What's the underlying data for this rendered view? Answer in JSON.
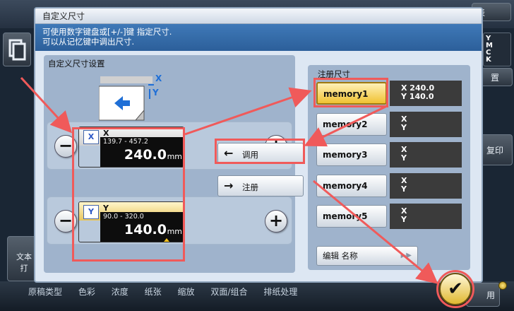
{
  "background": {
    "tab_right": "表",
    "right_button_top": "置",
    "right_button_mid": "复印",
    "cmyk_letters": "Y\nM\nC\nK",
    "left_button": "文本\n打",
    "bottom_bar": "原稿类型      色彩      浓度      纸张      缩放      双面/组合      排纸处理",
    "ok_button": "用"
  },
  "dialog": {
    "title": "自定义尺寸",
    "message_line1": "可使用数字键盘或[+/-]键 指定尺寸.",
    "message_line2": "可以从记忆键中调出尺寸."
  },
  "size_settings": {
    "title": "自定义尺寸设置",
    "diagram": {
      "x_label": "X",
      "y_label": "Y"
    },
    "x": {
      "axis": "X",
      "range": "139.7 - 457.2",
      "value": "240.0",
      "unit": "mm"
    },
    "y": {
      "axis": "Y",
      "range": "90.0 - 320.0",
      "value": "140.0",
      "unit": "mm"
    },
    "minus_label": "−",
    "plus_label": "+"
  },
  "middle_buttons": {
    "recall": {
      "arrow": "←",
      "label": "调用"
    },
    "register": {
      "arrow": "→",
      "label": "注册"
    }
  },
  "registered_sizes": {
    "title": "注册尺寸",
    "items": [
      {
        "name": "memory1",
        "x": "X 240.0",
        "y": "Y 140.0",
        "selected": true
      },
      {
        "name": "memory2",
        "x": "X",
        "y": "Y",
        "selected": false
      },
      {
        "name": "memory3",
        "x": "X",
        "y": "Y",
        "selected": false
      },
      {
        "name": "memory4",
        "x": "X",
        "y": "Y",
        "selected": false
      },
      {
        "name": "memory5",
        "x": "X",
        "y": "Y",
        "selected": false
      }
    ],
    "edit_name": "编辑 名称",
    "edit_name_arrow": "▶▶"
  },
  "ok_symbol": "✔",
  "colors": {
    "annotation_red": "#f05a5a",
    "message_bar": "#3a70ae",
    "selected_yellow": "#f0c232"
  }
}
